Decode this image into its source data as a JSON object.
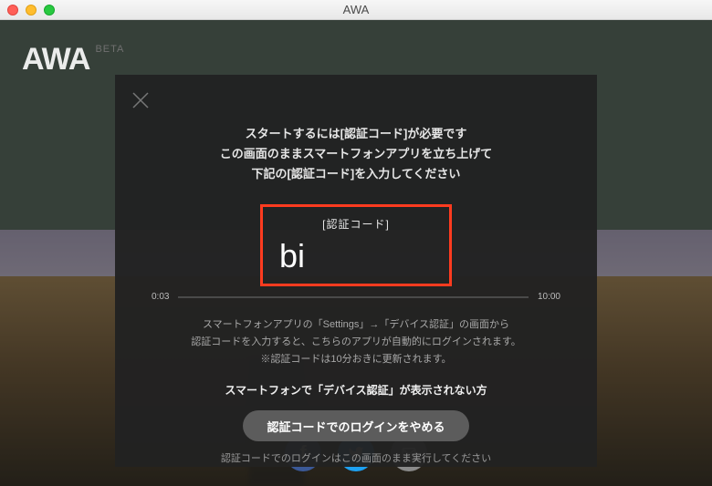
{
  "window": {
    "title": "AWA"
  },
  "logo": {
    "text": "AWA",
    "beta": "BETA"
  },
  "modal": {
    "line1": "スタートするには[認証コード]が必要です",
    "line2": "この画面のままスマートフォンアプリを立ち上げて",
    "line3": "下記の[認証コード]を入力してください",
    "code_label": "[認証コード]",
    "code_value": "bi",
    "elapsed": "0:03",
    "total": "10:00",
    "help1": "スマートフォンアプリの「Settings」→「デバイス認証」の画面から",
    "help2": "認証コードを入力すると、こちらのアプリが自動的にログインされます。",
    "help3": "※認証コードは10分おきに更新されます。",
    "link": "スマートフォンで「デバイス認証」が表示されない方",
    "stop_button": "認証コードでのログインをやめる",
    "footer": "認証コードでのログインはこの画面のまま実行してください"
  }
}
